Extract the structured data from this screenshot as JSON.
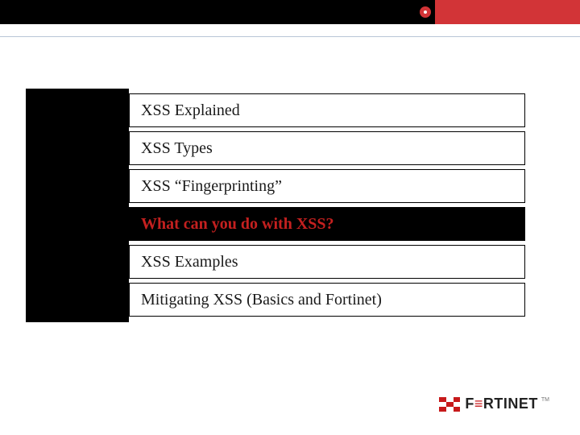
{
  "agenda": {
    "items": [
      {
        "label": "XSS Explained",
        "active": false
      },
      {
        "label": "XSS Types",
        "active": false
      },
      {
        "label": "XSS “Fingerprinting”",
        "active": false
      },
      {
        "label": "What can you do with XSS?",
        "active": true
      },
      {
        "label": "XSS Examples",
        "active": false
      },
      {
        "label": "Mitigating XSS (Basics and Fortinet)",
        "active": false
      }
    ]
  },
  "footer": {
    "brand_prefix": "F",
    "brand_accent": "≡",
    "brand_suffix": "RTINET",
    "tm": "TM"
  },
  "colors": {
    "red": "#d23437",
    "highlight_text": "#c4201f",
    "black": "#000000",
    "rule": "#b8c6d7"
  }
}
